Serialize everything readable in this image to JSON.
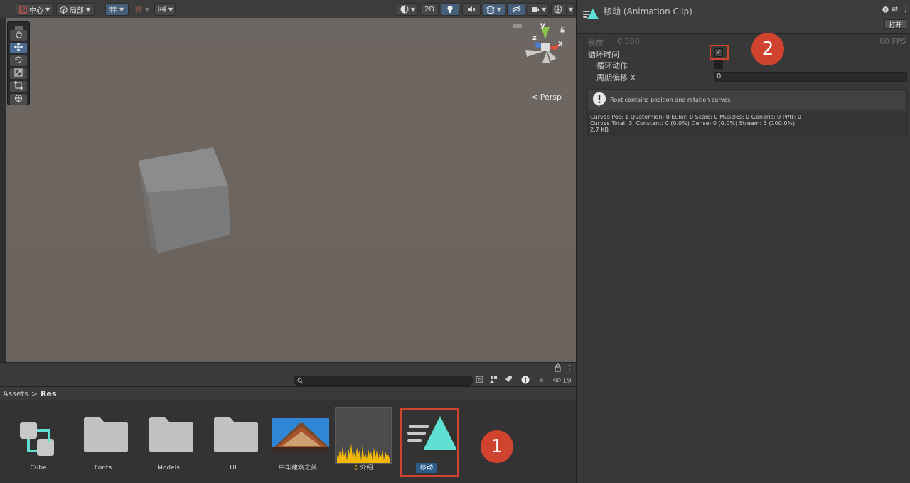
{
  "scene_toolbar": {
    "pivot_label": "中心",
    "space_label": "局部",
    "mode_2d_label": "2D"
  },
  "scene": {
    "persp_label": "< Persp",
    "gizmo_axes": {
      "x": "x",
      "y": "y",
      "z": "z"
    }
  },
  "project": {
    "visibility_count": "19",
    "breadcrumb": {
      "root": "Assets",
      "separator": ">",
      "current": "Res"
    },
    "assets": [
      {
        "name": "Cube",
        "icon": "prefab-variant-icon"
      },
      {
        "name": "Fonts",
        "icon": "folder-icon"
      },
      {
        "name": "Models",
        "icon": "folder-icon"
      },
      {
        "name": "UI",
        "icon": "folder-icon"
      },
      {
        "name": "中华建筑之美",
        "icon": "image-thumbnail"
      },
      {
        "name": "介绍",
        "icon": "audio-clip-icon"
      },
      {
        "name": "移动",
        "icon": "animation-clip-icon",
        "selected": true
      }
    ]
  },
  "inspector": {
    "title": "移动 (Animation Clip)",
    "open_button": "打开",
    "length_label": "长度",
    "length_value": "0.500",
    "fps_value": "60 FPS",
    "loop_time_label": "循环时间",
    "loop_time_checked": true,
    "loop_pose_label": "循环动作",
    "loop_pose_checked": false,
    "cycle_offset_label": "周期偏移 X",
    "cycle_offset_value": "0",
    "help_message": "Root contains position and rotation curves",
    "stats_line1": "Curves Pos: 1 Quaternion: 0 Euler: 0 Scale: 0 Muscles: 0 Generic: 0 PPtr: 0",
    "stats_line2": "Curves Total: 3, Constant: 0 (0.0%) Dense: 0 (0.0%) Stream: 3 (100.0%)",
    "stats_line3": "2.7 KB"
  },
  "annotations": {
    "badge1": "1",
    "badge2": "2"
  },
  "colors": {
    "accent_red": "#d0432f",
    "selection_blue": "#2c5d87",
    "anim_teal": "#5fe0d2"
  }
}
